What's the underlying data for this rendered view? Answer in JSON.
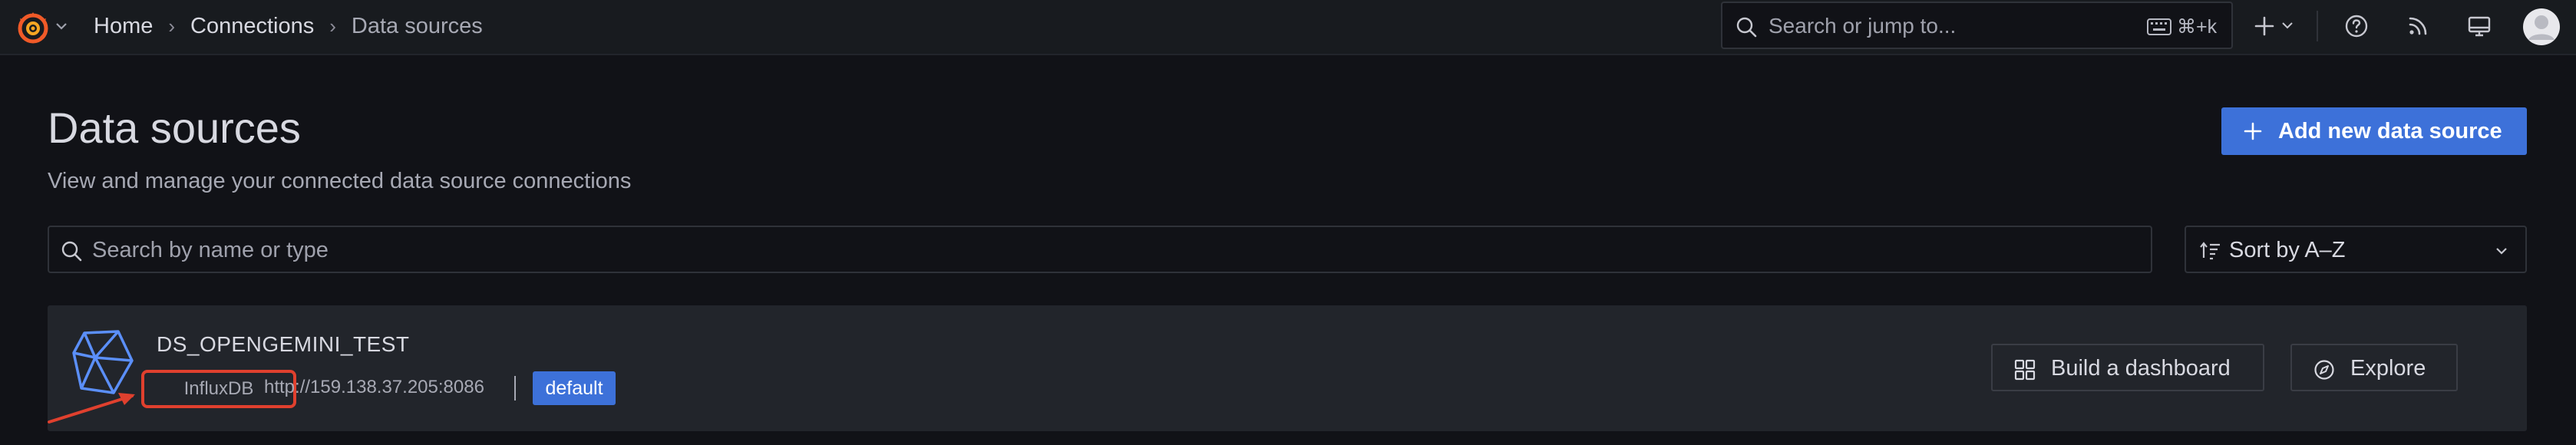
{
  "colors": {
    "background": "#111217",
    "topbar": "#181b1f",
    "card": "#22252b",
    "primary": "#3d71d9",
    "logo_orange": "#f05a28",
    "highlight_red": "#e0402e"
  },
  "topbar": {
    "logo_icon": "grafana-logo",
    "breadcrumb": {
      "home": "Home",
      "connections": "Connections",
      "current": "Data sources",
      "separator": "›"
    },
    "search": {
      "placeholder": "Search or jump to...",
      "shortcut": "⌘+k"
    },
    "icons": [
      "plus-icon",
      "chevron-down-icon",
      "help-icon",
      "news-rss-icon",
      "kiosk-monitor-icon",
      "user-avatar"
    ]
  },
  "page": {
    "title": "Data sources",
    "subtitle": "View and manage your connected data source connections",
    "add_button": "Add new data source",
    "search_placeholder": "Search by name or type",
    "sort_value": "Sort by A–Z"
  },
  "datasource": {
    "name": "DS_OPENGEMINI_TEST",
    "type": "InfluxDB",
    "url": "http://159.138.37.205:8086",
    "badge": "default",
    "build_button": "Build a dashboard",
    "explore_button": "Explore"
  }
}
